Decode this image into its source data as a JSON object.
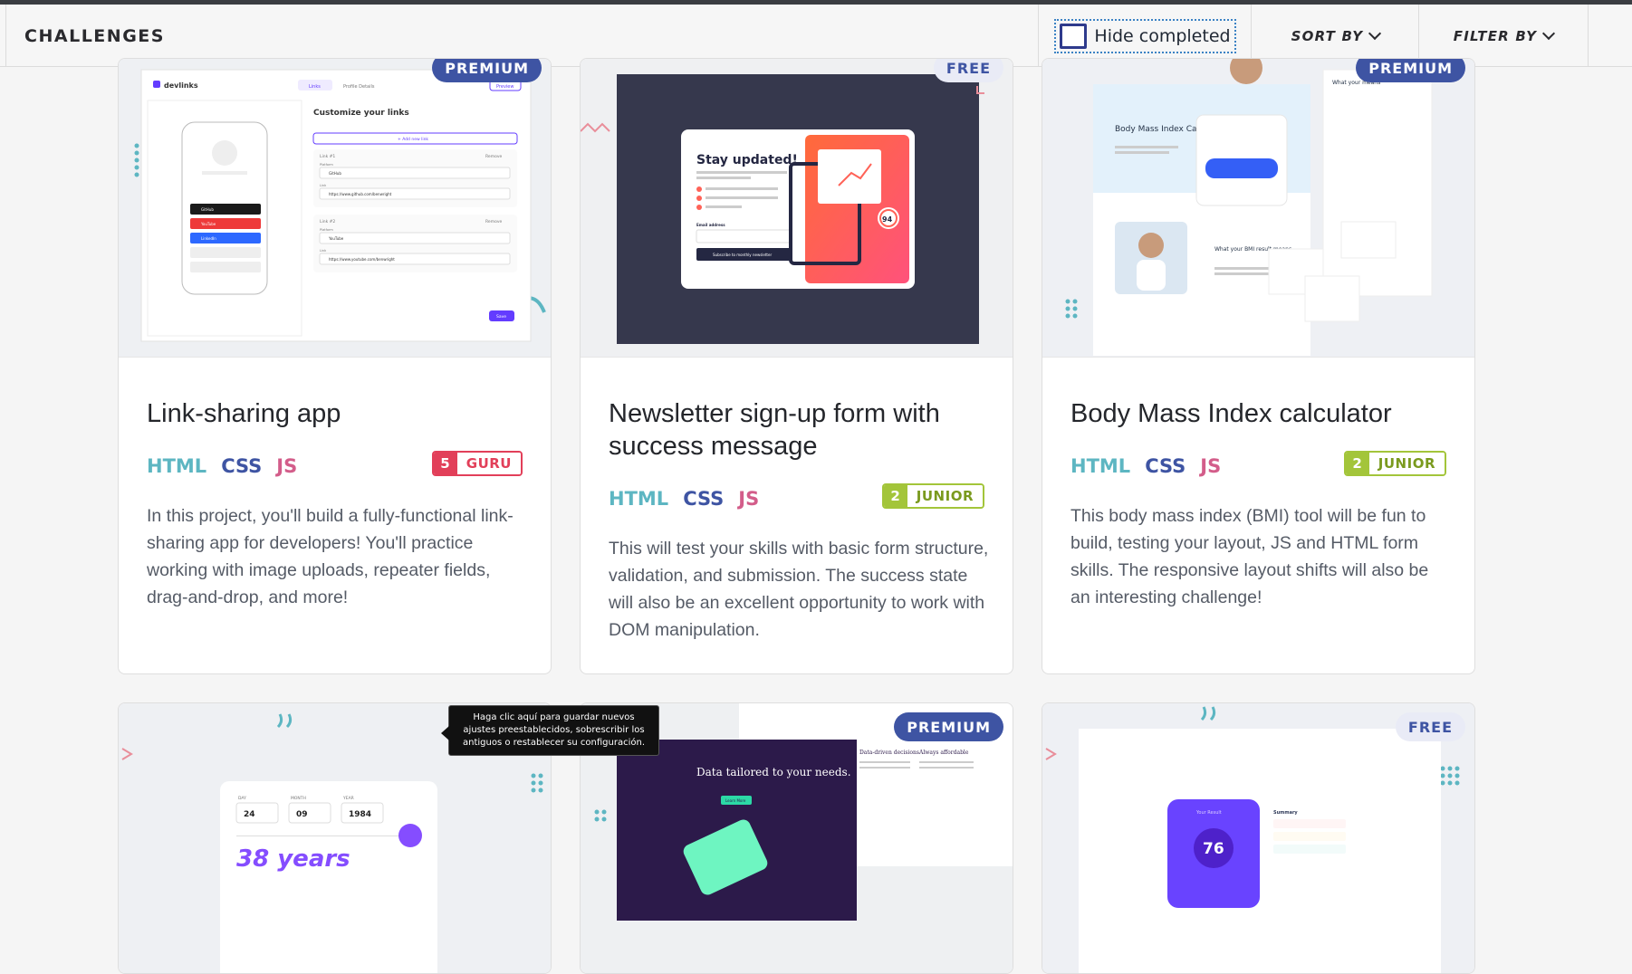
{
  "toolbar": {
    "title": "CHALLENGES",
    "hide_completed_label": "Hide completed",
    "sort_label": "SORT BY",
    "filter_label": "FILTER BY"
  },
  "cards": [
    {
      "badge": "PREMIUM",
      "title": "Link-sharing app",
      "tags": [
        "HTML",
        "CSS",
        "JS"
      ],
      "level_num": "5",
      "level_label": "GURU",
      "description": "In this project, you'll build a fully-functional link-sharing app for developers! You'll practice working with image uploads, repeater fields, drag-and-drop, and more!",
      "preview": {
        "logo": "devlinks",
        "tab_links": "Links",
        "tab_profile": "Profile Details",
        "preview_btn": "Preview",
        "heading": "Customize your links",
        "add_link": "+ Add new link",
        "link1": "Link #1",
        "link2": "Link #2",
        "remove": "Remove",
        "platform": "Platform",
        "link": "Link",
        "github": "GitHub",
        "youtube": "YouTube",
        "linkedin": "LinkedIn",
        "url1": "https://www.github.com/benwright",
        "url2": "https://www.youtube.com/benwright",
        "save": "Save"
      }
    },
    {
      "badge": "FREE",
      "title": "Newsletter sign-up form with success message",
      "tags": [
        "HTML",
        "CSS",
        "JS"
      ],
      "level_num": "2",
      "level_label": "JUNIOR",
      "description": "This will test your skills with basic form structure, validation, and submission. The success state will also be an excellent opportunity to work with DOM manipulation.",
      "preview": {
        "heading": "Stay updated!",
        "subscribe": "Subscribe to monthly newsletter",
        "email_label": "Email address",
        "score": "94"
      }
    },
    {
      "badge": "PREMIUM",
      "title": "Body Mass Index calculator",
      "tags": [
        "HTML",
        "CSS",
        "JS"
      ],
      "level_num": "2",
      "level_label": "JUNIOR",
      "description": "This body mass index (BMI) tool will be fun to build, testing your layout, JS and HTML form skills. The responsive layout shifts will also be an interesting challenge!",
      "preview": {
        "heading1": "Body Mass Index Calculator",
        "heading2": "What your BMI result means",
        "heading3": "What your means"
      }
    },
    {
      "badge": "",
      "preview": {
        "day": "DAY",
        "month": "MONTH",
        "year": "YEAR",
        "d": "24",
        "m": "09",
        "y": "1984",
        "years": "38 years"
      }
    },
    {
      "badge": "PREMIUM",
      "preview": {
        "heading": "Data tailored to your needs.",
        "btn": "Learn More",
        "col1": "Data-driven decisions",
        "col2": "Always affordable"
      }
    },
    {
      "badge": "FREE",
      "preview": {
        "result": "Your Result",
        "score": "76",
        "summary": "Summary"
      }
    }
  ],
  "tooltip": "Haga clic aquí para guardar nuevos ajustes preestablecidos, sobrescribir los antiguos o restablecer su configuración.",
  "colors": {
    "premium": "#3e54a3",
    "html": "#5db6c2",
    "css": "#3e54a3",
    "js": "#d35d8a",
    "guru": "#e23f59",
    "junior": "#a3c53a"
  }
}
